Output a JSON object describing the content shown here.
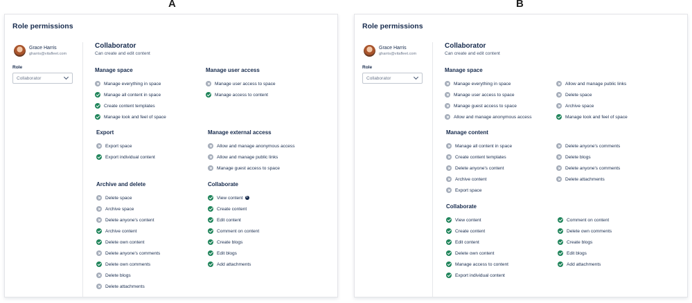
{
  "variants": {
    "a": "A",
    "b": "B"
  },
  "user": {
    "name": "Grace Harris",
    "email": "gharris@vitafleet.com"
  },
  "panel_a": {
    "title": "Role permissions",
    "role_label": "Role",
    "role_select_value": "Collaborator",
    "role_name": "Collaborator",
    "role_description": "Can create and edit content",
    "sections": {
      "manage_space": {
        "title": "Manage space",
        "items": [
          {
            "label": "Manage everything in space",
            "state": "denied"
          },
          {
            "label": "Manage all content in space",
            "state": "allowed"
          },
          {
            "label": "Create content templates",
            "state": "allowed"
          },
          {
            "label": "Manage look and feel of space",
            "state": "allowed"
          }
        ]
      },
      "manage_user_access": {
        "title": "Manage user access",
        "items": [
          {
            "label": "Manage user access to space",
            "state": "denied"
          },
          {
            "label": "Manage access to content",
            "state": "allowed"
          }
        ]
      },
      "export": {
        "title": "Export",
        "items": [
          {
            "label": "Export space",
            "state": "denied"
          },
          {
            "label": "Export individual content",
            "state": "allowed"
          }
        ]
      },
      "manage_external_access": {
        "title": "Manage external access",
        "items": [
          {
            "label": "Allow and manage anonymous access",
            "state": "denied"
          },
          {
            "label": "Allow and manage public links",
            "state": "denied"
          },
          {
            "label": "Manage guest access to space",
            "state": "denied"
          }
        ]
      },
      "archive_delete": {
        "title": "Archive and delete",
        "items": [
          {
            "label": "Delete space",
            "state": "denied"
          },
          {
            "label": "Archive space",
            "state": "denied"
          },
          {
            "label": "Delete anyone's content",
            "state": "denied"
          },
          {
            "label": "Archive content",
            "state": "allowed"
          },
          {
            "label": "Delete own content",
            "state": "allowed"
          },
          {
            "label": "Delete anyone's comments",
            "state": "denied"
          },
          {
            "label": "Delete own comments",
            "state": "allowed"
          },
          {
            "label": "Delete blogs",
            "state": "denied"
          },
          {
            "label": "Delete attachments",
            "state": "denied"
          }
        ]
      },
      "collaborate": {
        "title": "Collaborate",
        "items": [
          {
            "label": "View content",
            "state": "allowed",
            "info": "i"
          },
          {
            "label": "Create content",
            "state": "allowed"
          },
          {
            "label": "Edit content",
            "state": "allowed"
          },
          {
            "label": "Comment on content",
            "state": "allowed"
          },
          {
            "label": "Create blogs",
            "state": "allowed"
          },
          {
            "label": "Edit blogs",
            "state": "allowed"
          },
          {
            "label": "Add attachments",
            "state": "allowed"
          }
        ]
      }
    }
  },
  "panel_b": {
    "title": "Role permissions",
    "role_label": "Role",
    "role_select_value": "Collaborator",
    "role_name": "Collaborator",
    "role_description": "Can create and edit content",
    "sections": {
      "manage_space": {
        "title": "Manage space",
        "col1": [
          {
            "label": "Manage everything in space",
            "state": "denied"
          },
          {
            "label": "Manage user access to space",
            "state": "denied"
          },
          {
            "label": "Manage guest access to space",
            "state": "denied"
          },
          {
            "label": "Allow and manage anonymous access",
            "state": "denied"
          }
        ],
        "col2": [
          {
            "label": "Allow and manage public links",
            "state": "denied"
          },
          {
            "label": "Delete space",
            "state": "denied"
          },
          {
            "label": "Archive space",
            "state": "denied"
          },
          {
            "label": "Manage look and feel of space",
            "state": "allowed"
          }
        ]
      },
      "manage_content": {
        "title": "Manage content",
        "col1": [
          {
            "label": "Manage all content in space",
            "state": "denied"
          },
          {
            "label": "Create content templates",
            "state": "denied"
          },
          {
            "label": "Delete anyone's content",
            "state": "denied"
          },
          {
            "label": "Archive content",
            "state": "denied"
          },
          {
            "label": "Export space",
            "state": "denied"
          }
        ],
        "col2": [
          {
            "label": "Delete anyone's comments",
            "state": "denied"
          },
          {
            "label": "Delete blogs",
            "state": "denied"
          },
          {
            "label": "Delete anyone's comments",
            "state": "denied"
          },
          {
            "label": "Delete attachments",
            "state": "denied"
          }
        ]
      },
      "collaborate": {
        "title": "Collaborate",
        "col1": [
          {
            "label": "View content",
            "state": "allowed"
          },
          {
            "label": "Create content",
            "state": "allowed"
          },
          {
            "label": "Edit content",
            "state": "allowed"
          },
          {
            "label": "Delete own content",
            "state": "allowed"
          },
          {
            "label": "Manage access to content",
            "state": "allowed"
          },
          {
            "label": "Export individual content",
            "state": "allowed"
          }
        ],
        "col2": [
          {
            "label": "Comment on content",
            "state": "allowed"
          },
          {
            "label": "Delete own comments",
            "state": "allowed"
          },
          {
            "label": "Create blogs",
            "state": "allowed"
          },
          {
            "label": "Edit blogs",
            "state": "allowed"
          },
          {
            "label": "Add attachments",
            "state": "allowed"
          }
        ]
      }
    }
  }
}
